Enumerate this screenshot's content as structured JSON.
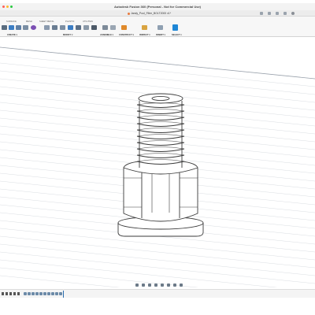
{
  "window": {
    "title": "Autodesk Fusion 360 (Personal - Not for Commercial Use)"
  },
  "document": {
    "tab_label": "Jandy_Pool_Filter_BOLT2000 v1*"
  },
  "toolbar": {
    "workspace_tabs": [
      "SURFACE",
      "MESH",
      "SHEET METAL",
      "PLASTIC",
      "UTILITIES"
    ],
    "active_workspace_tab": "SOLID",
    "groups": {
      "create": "CREATE ▾",
      "modify": "MODIFY ▾",
      "assemble": "ASSEMBLE ▾",
      "construct": "CONSTRUCT ▾",
      "inspect": "INSPECT ▾",
      "insert": "INSERT ▾",
      "select": "SELECT ▾"
    }
  },
  "colors": {
    "accent": "#1d6fb8",
    "toolbar_blue": "#3b7dc4",
    "toolbar_orange": "#e08a2b",
    "toolbar_purple": "#7b4fb3",
    "model_line": "#3a3a3a",
    "grid_line": "#d9dde2"
  },
  "icons": {
    "navigation": [
      "orbit-icon",
      "pan-icon",
      "look-at-icon",
      "zoom-icon",
      "fit-icon",
      "display-settings-icon",
      "grid-settings-icon",
      "viewports-icon"
    ],
    "timeline": [
      "go-to-start-icon",
      "step-back-icon",
      "play-icon",
      "step-forward-icon",
      "go-to-end-icon"
    ]
  }
}
